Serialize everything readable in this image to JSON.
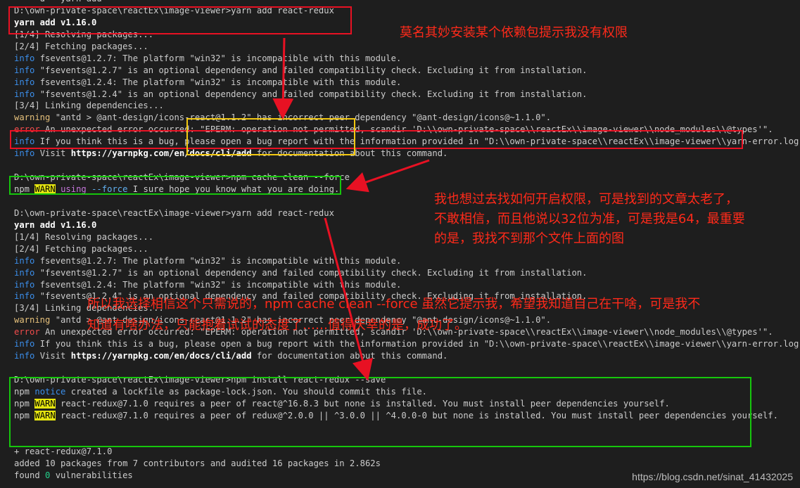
{
  "terminal": {
    "lines": [
      {
        "segments": [
          {
            "t": "    \"d\" \"yarn add \"",
            "c": "plain"
          }
        ]
      },
      {
        "segments": [
          {
            "t": "D:\\own-private-space\\reactEx\\image-viewer>yarn add react-redux",
            "c": "plain"
          }
        ]
      },
      {
        "segments": [
          {
            "t": "yarn add v1.16.0",
            "c": "bold"
          }
        ]
      },
      {
        "segments": [
          {
            "t": "[1/4] Resolving packages...",
            "c": "plain"
          }
        ]
      },
      {
        "segments": [
          {
            "t": "[2/4] Fetching packages...",
            "c": "plain"
          }
        ]
      },
      {
        "segments": [
          {
            "t": "info",
            "c": "info"
          },
          {
            "t": " fsevents@1.2.7: The platform \"win32\" is incompatible with this module.",
            "c": "plain"
          }
        ]
      },
      {
        "segments": [
          {
            "t": "info",
            "c": "info"
          },
          {
            "t": " \"fsevents@1.2.7\" is an optional dependency and failed compatibility check. Excluding it from installation.",
            "c": "plain"
          }
        ]
      },
      {
        "segments": [
          {
            "t": "info",
            "c": "info"
          },
          {
            "t": " fsevents@1.2.4: The platform \"win32\" is incompatible with this module.",
            "c": "plain"
          }
        ]
      },
      {
        "segments": [
          {
            "t": "info",
            "c": "info"
          },
          {
            "t": " \"fsevents@1.2.4\" is an optional dependency and failed compatibility check. Excluding it from installation.",
            "c": "plain"
          }
        ]
      },
      {
        "segments": [
          {
            "t": "[3/4] Linking dependencies...",
            "c": "plain"
          }
        ]
      },
      {
        "segments": [
          {
            "t": "warning",
            "c": "warning"
          },
          {
            "t": " \"antd > @ant-design/icons-react@1.1.2\" has incorrect peer dependency \"@ant-design/icons@~1.1.0\".",
            "c": "plain"
          }
        ]
      },
      {
        "segments": [
          {
            "t": "error",
            "c": "error"
          },
          {
            "t": " An unexpected error occurred: \"EPERM: operation not permitted, scandir 'D:\\\\own-private-space\\\\reactEx\\\\image-viewer\\\\node_modules\\\\@types'\".",
            "c": "plain"
          }
        ]
      },
      {
        "segments": [
          {
            "t": "info",
            "c": "info"
          },
          {
            "t": " If you think this is a bug, please open a bug report with the information provided in \"D:\\\\own-private-space\\\\reactEx\\\\image-viewer\\\\yarn-error.log\".",
            "c": "plain"
          }
        ]
      },
      {
        "segments": [
          {
            "t": "info",
            "c": "info"
          },
          {
            "t": " Visit ",
            "c": "plain"
          },
          {
            "t": "https://yarnpkg.com/en/docs/cli/add",
            "c": "bold"
          },
          {
            "t": " for documentation about this command.",
            "c": "plain"
          }
        ]
      },
      {
        "segments": [
          {
            "t": "",
            "c": "plain"
          }
        ]
      },
      {
        "segments": [
          {
            "t": "D:\\own-private-space\\reactEx\\image-viewer>npm cache clean --force",
            "c": "plain"
          }
        ]
      },
      {
        "segments": [
          {
            "t": "npm ",
            "c": "plain"
          },
          {
            "t": "WARN",
            "c": "warnbadge"
          },
          {
            "t": " ",
            "c": "plain"
          },
          {
            "t": "using",
            "c": "using"
          },
          {
            "t": " ",
            "c": "plain"
          },
          {
            "t": "--force",
            "c": "force"
          },
          {
            "t": " I sure hope you know what you are doing.",
            "c": "plain"
          }
        ]
      },
      {
        "segments": [
          {
            "t": "",
            "c": "plain"
          }
        ]
      },
      {
        "segments": [
          {
            "t": "D:\\own-private-space\\reactEx\\image-viewer>yarn add react-redux",
            "c": "plain"
          }
        ]
      },
      {
        "segments": [
          {
            "t": "yarn add v1.16.0",
            "c": "bold"
          }
        ]
      },
      {
        "segments": [
          {
            "t": "[1/4] Resolving packages...",
            "c": "plain"
          }
        ]
      },
      {
        "segments": [
          {
            "t": "[2/4] Fetching packages...",
            "c": "plain"
          }
        ]
      },
      {
        "segments": [
          {
            "t": "info",
            "c": "info"
          },
          {
            "t": " fsevents@1.2.7: The platform \"win32\" is incompatible with this module.",
            "c": "plain"
          }
        ]
      },
      {
        "segments": [
          {
            "t": "info",
            "c": "info"
          },
          {
            "t": " \"fsevents@1.2.7\" is an optional dependency and failed compatibility check. Excluding it from installation.",
            "c": "plain"
          }
        ]
      },
      {
        "segments": [
          {
            "t": "info",
            "c": "info"
          },
          {
            "t": " fsevents@1.2.4: The platform \"win32\" is incompatible with this module.",
            "c": "plain"
          }
        ]
      },
      {
        "segments": [
          {
            "t": "info",
            "c": "info"
          },
          {
            "t": " \"fsevents@1.2.4\" is an optional dependency and failed compatibility check. Excluding it from installation.",
            "c": "plain"
          }
        ]
      },
      {
        "segments": [
          {
            "t": "[3/4] Linking dependencies...",
            "c": "plain"
          }
        ]
      },
      {
        "segments": [
          {
            "t": "warning",
            "c": "warning"
          },
          {
            "t": " \"antd > @ant-design/icons-react@1.1.2\" has incorrect peer dependency \"@ant-design/icons@~1.1.0\".",
            "c": "plain"
          }
        ]
      },
      {
        "segments": [
          {
            "t": "error",
            "c": "error"
          },
          {
            "t": " An unexpected error occurred: \"EPERM: operation not permitted, scandir 'D:\\\\own-private-space\\\\reactEx\\\\image-viewer\\\\node_modules\\\\@types'\".",
            "c": "plain"
          }
        ]
      },
      {
        "segments": [
          {
            "t": "info",
            "c": "info"
          },
          {
            "t": " If you think this is a bug, please open a bug report with the information provided in \"D:\\\\own-private-space\\\\reactEx\\\\image-viewer\\\\yarn-error.log\".",
            "c": "plain"
          }
        ]
      },
      {
        "segments": [
          {
            "t": "info",
            "c": "info"
          },
          {
            "t": " Visit ",
            "c": "plain"
          },
          {
            "t": "https://yarnpkg.com/en/docs/cli/add",
            "c": "bold"
          },
          {
            "t": " for documentation about this command.",
            "c": "plain"
          }
        ]
      },
      {
        "segments": [
          {
            "t": "",
            "c": "plain"
          }
        ]
      },
      {
        "segments": [
          {
            "t": "D:\\own-private-space\\reactEx\\image-viewer>npm install react-redux --save",
            "c": "plain"
          }
        ]
      },
      {
        "segments": [
          {
            "t": "npm ",
            "c": "plain"
          },
          {
            "t": "notice",
            "c": "notice"
          },
          {
            "t": " created a lockfile as package-lock.json. You should commit this file.",
            "c": "plain"
          }
        ]
      },
      {
        "segments": [
          {
            "t": "npm ",
            "c": "plain"
          },
          {
            "t": "WARN",
            "c": "warnbadge"
          },
          {
            "t": " react-redux@7.1.0 requires a peer of react@^16.8.3 but none is installed. You must install peer dependencies yourself.",
            "c": "plain"
          }
        ]
      },
      {
        "segments": [
          {
            "t": "npm ",
            "c": "plain"
          },
          {
            "t": "WARN",
            "c": "warnbadge"
          },
          {
            "t": " react-redux@7.1.0 requires a peer of redux@^2.0.0 || ^3.0.0 || ^4.0.0-0 but none is installed. You must install peer dependencies yourself.",
            "c": "plain"
          }
        ]
      },
      {
        "segments": [
          {
            "t": "",
            "c": "plain"
          }
        ]
      },
      {
        "segments": [
          {
            "t": "",
            "c": "plain"
          }
        ]
      },
      {
        "segments": [
          {
            "t": "+ react-redux@7.1.0",
            "c": "plain"
          }
        ]
      },
      {
        "segments": [
          {
            "t": "added 10 packages from 7 contributors and audited 16 packages in 2.862s",
            "c": "plain"
          }
        ]
      },
      {
        "segments": [
          {
            "t": "found ",
            "c": "plain"
          },
          {
            "t": "0",
            "c": "zero"
          },
          {
            "t": " vulnerabilities",
            "c": "plain"
          }
        ]
      }
    ]
  },
  "annotations": {
    "note1": "莫名其妙安装某个依赖包提示我没有权限",
    "note2": "我也想过去找如何开启权限，可是找到的文章太老了，\n不敢相信，而且他说以32位为准，可是我是64，最重要\n的是，我找不到那个文件上面的图",
    "note3": "所以我选择相信这个只需说的，npm cache clean --force 虽然它提示我，希望我知道自己在干啥，可是我不\n知道有啥办法，只能抱着试试的态度了……值得庆幸的是，成功了。"
  },
  "watermark": "https://blog.csdn.net/sinat_41432025",
  "colors": {
    "highlight_red": "#e81123",
    "highlight_yellow": "#f2c811",
    "highlight_green": "#16c60c",
    "annotation": "#ff2a1a"
  }
}
